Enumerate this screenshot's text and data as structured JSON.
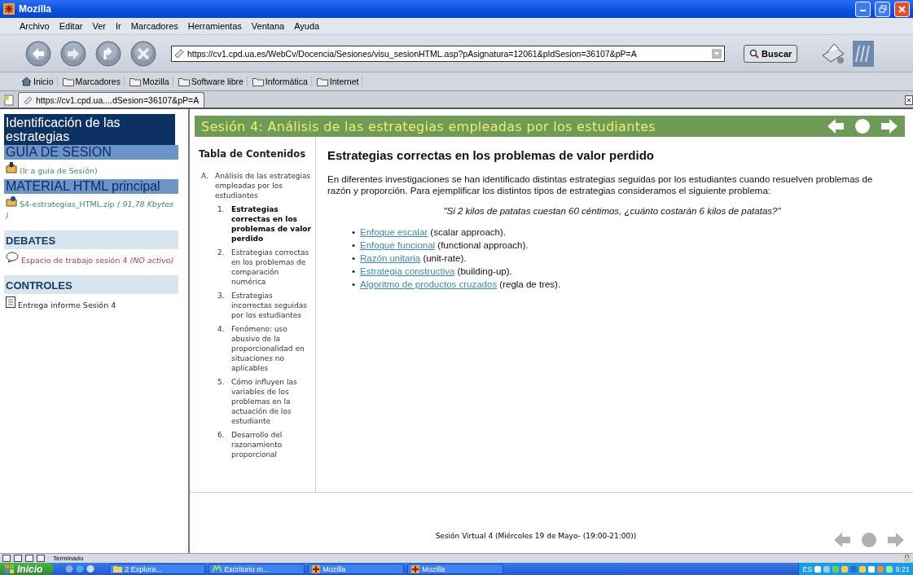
{
  "window": {
    "title": "Mozilla"
  },
  "menu_bar": [
    "Archivo",
    "Editar",
    "Ver",
    "Ir",
    "Marcadores",
    "Herramientas",
    "Ventana",
    "Ayuda"
  ],
  "toolbar": {
    "address": "https://cv1.cpd.ua.es/WebCv/Docencia/Sesiones/visu_sesionHTML.asp?pAsignatura=12061&pIdSesion=36107&pP=A",
    "search_button": "Buscar"
  },
  "bookmarks": [
    {
      "label": "Inicio",
      "kind": "home"
    },
    {
      "label": "Marcadores",
      "kind": "folder"
    },
    {
      "label": "Mozilla",
      "kind": "folder"
    },
    {
      "label": "Software libre",
      "kind": "folder"
    },
    {
      "label": "Informática",
      "kind": "folder"
    },
    {
      "label": "Internet",
      "kind": "folder"
    }
  ],
  "tabs": [
    {
      "label": "https://cv1.cpd.ua....dSesion=36107&pP=A",
      "selected": true
    }
  ],
  "sidebar": {
    "title": "Identificación de las estrategias",
    "sections": [
      {
        "heading": "GUÍA DE SESION",
        "kind": "large",
        "items": [
          {
            "text": "(Ir a guía de Sesión)",
            "kind": "guide"
          }
        ]
      },
      {
        "heading": "MATERIAL HTML principal",
        "kind": "large",
        "items": [
          {
            "text": "S4-estrategias_HTML.zip",
            "note": "( 91,78 Kbytes )",
            "kind": "file"
          }
        ]
      },
      {
        "heading": "DEBATES",
        "kind": "small",
        "items": [
          {
            "text": "Espacio de trabajo sesión 4",
            "note": "(NO activo)",
            "kind": "forum"
          }
        ]
      },
      {
        "heading": "CONTROLES",
        "kind": "small",
        "items": [
          {
            "text": "Entrega informe Sesión 4",
            "kind": "document"
          }
        ]
      }
    ]
  },
  "page_header": {
    "title": "Sesión 4: Análisis de las estrategias empleadas por los estudiantes"
  },
  "toc": {
    "heading": "Tabla de Contenidos",
    "items": [
      {
        "marker": "A.",
        "text": "Análisis de las estrategias empleadas por los estudiantes",
        "children": [
          {
            "marker": "1.",
            "text": "Estrategias correctas en los problemas de valor perdido",
            "selected": true
          },
          {
            "marker": "2.",
            "text": "Estrategias correctas en los problemas de comparación numérica",
            "selected": false
          },
          {
            "marker": "3.",
            "text": "Estrategias incorrectas seguidas por los estudiantes",
            "selected": false
          },
          {
            "marker": "4.",
            "text": "Fenómeno: uso abusivo de la proporcionalidad en situaciones no aplicables",
            "selected": false
          },
          {
            "marker": "5.",
            "text": "Cómo influyen las variables de los problemas en la actuación de los estudiante",
            "selected": false
          },
          {
            "marker": "6.",
            "text": "Desarrollo del razonamiento proporcional",
            "selected": false
          }
        ]
      }
    ]
  },
  "article": {
    "title": "Estrategias correctas en los problemas de valor perdido",
    "paragraph": "En diferentes investigaciones se han identificado distintas estrategias seguidas por los estudiantes cuando resuelven problemas de razón y proporción. Para ejemplificar los distintos tipos de estrategias consideramos el siguiente problema:",
    "quote": "\"Si 2 kilos de patatas cuestan 60 céntimos, ¿cuánto costarán 6 kilos de patatas?\"",
    "items": [
      {
        "bullet": "•",
        "link": "Enfoque escalar",
        "text": "(scalar approach)."
      },
      {
        "bullet": "•",
        "link": "Enfoque funcional",
        "text": "(functional approach)."
      },
      {
        "bullet": "•",
        "link": "Razón unitaria",
        "text": "(unit-rate)."
      },
      {
        "bullet": "•",
        "link": "Estrategia constructiva",
        "text": "(building-up)."
      },
      {
        "bullet": "•",
        "link": "Algoritmo de productos cruzados",
        "text": "(regla de tres)."
      }
    ]
  },
  "footer": {
    "text": "Sesión Virtual 4 (Miércoles 19 de Mayo- (19:00-21:00))"
  },
  "status_bar": {
    "text": "Terminado"
  },
  "taskbar": {
    "start": "Inicio",
    "tasks": [
      {
        "label": "2 Explora...",
        "kind": "folder"
      },
      {
        "label": "Escritorio m...",
        "kind": "app"
      },
      {
        "label": "Mozilla",
        "kind": "mozilla"
      },
      {
        "label": "Mozilla",
        "kind": "mozilla"
      }
    ],
    "language": "ES",
    "clock": "9:21"
  }
}
